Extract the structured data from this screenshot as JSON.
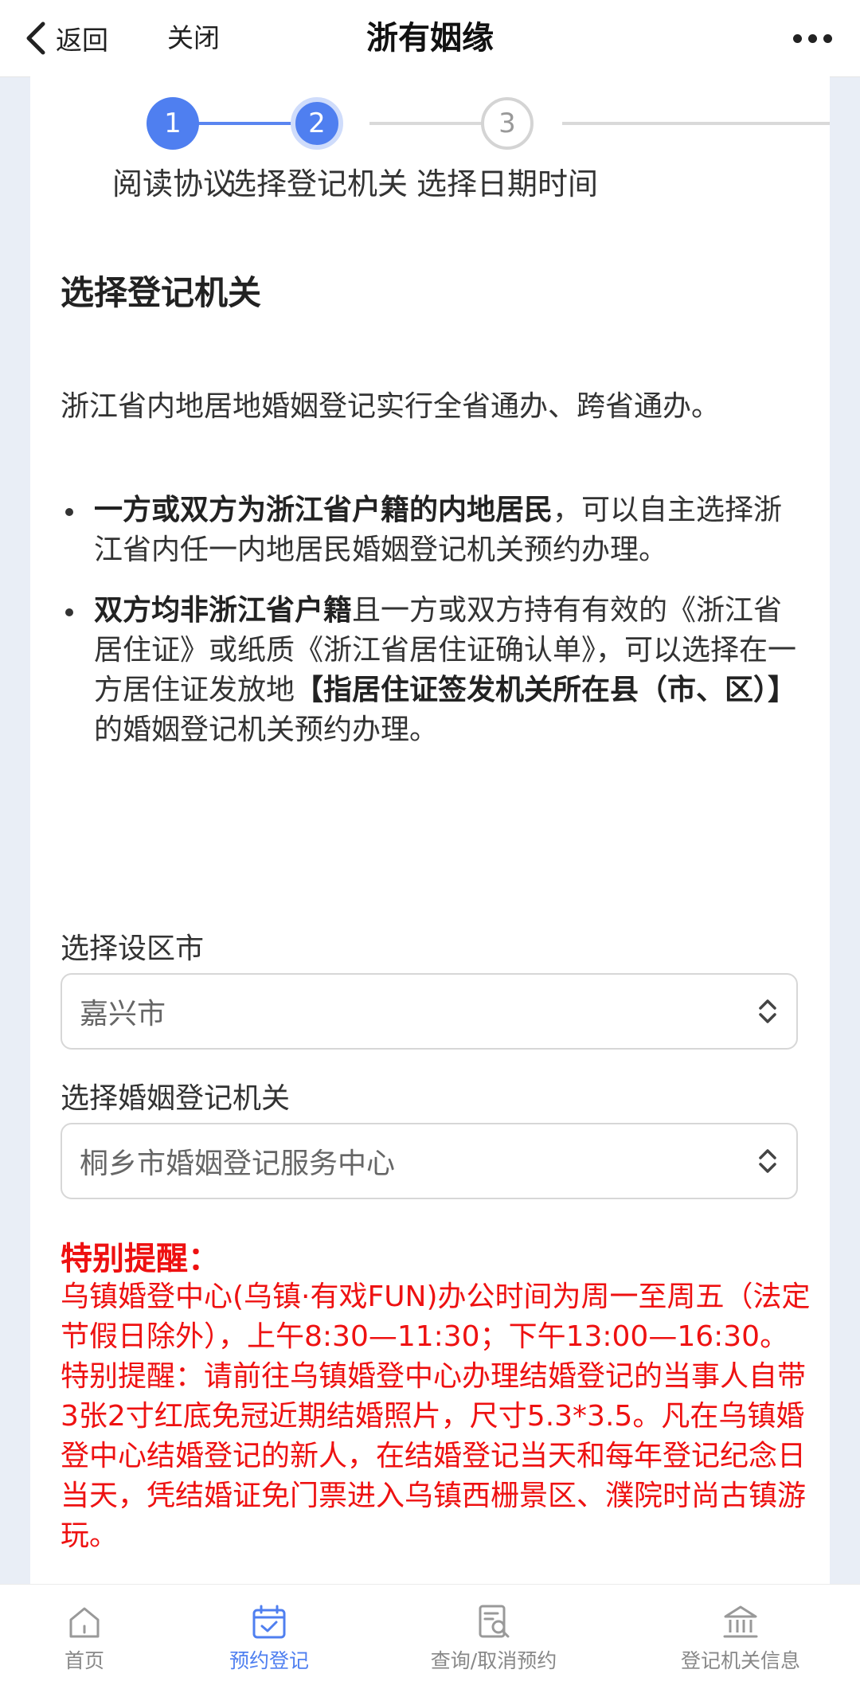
{
  "navbar": {
    "back_label": "返回",
    "close_label": "关闭",
    "title": "浙有姻缘"
  },
  "stepper": {
    "steps": [
      {
        "number": "1",
        "label": "阅读协议",
        "state": "done"
      },
      {
        "number": "2",
        "label": "选择登记机关",
        "state": "current"
      },
      {
        "number": "3",
        "label": "选择日期时间",
        "state": "todo"
      }
    ]
  },
  "section": {
    "title": "选择登记机关",
    "intro": "浙江省内地居地婚姻登记实行全省通办、跨省通办。",
    "bullets": [
      {
        "bold": "一方或双方为浙江省户籍的内地居民",
        "text": "，可以自主选择浙江省内任一内地居民婚姻登记机关预约办理。"
      },
      {
        "bold": "双方均非浙江省户籍",
        "text": "且一方或双方持有有效的《浙江省居住证》或纸质《浙江省居住证确认单》，可以选择在一方居住证发放地",
        "bold2": "【指居住证签发机关所在县（市、区）】",
        "text2": "的婚姻登记机关预约办理。"
      }
    ]
  },
  "form": {
    "city_label": "选择设区市",
    "city_value": "嘉兴市",
    "office_label": "选择婚姻登记机关",
    "office_value": "桐乡市婚姻登记服务中心"
  },
  "reminder": {
    "title": "特别提醒：",
    "text": "乌镇婚登中心(乌镇·有戏FUN)办公时间为周一至周五（法定节假日除外），上午8:30—11:30；下午13:00—16:30。特别提醒：请前往乌镇婚登中心办理结婚登记的当事人自带3张2寸红底免冠近期结婚照片，尺寸5.3*3.5。凡在乌镇婚登中心结婚登记的新人，在结婚登记当天和每年登记纪念日当天，凭结婚证免门票进入乌镇西栅景区、濮院时尚古镇游玩。"
  },
  "tabbar": {
    "tabs": [
      {
        "label": "首页",
        "icon": "home-icon"
      },
      {
        "label": "预约登记",
        "icon": "calendar-check-icon"
      },
      {
        "label": "查询/取消预约",
        "icon": "search-document-icon"
      },
      {
        "label": "登记机关信息",
        "icon": "building-icon"
      }
    ]
  },
  "colors": {
    "accent": "#4f7ff0",
    "warning": "#ee1111",
    "background": "#e9eef6"
  }
}
